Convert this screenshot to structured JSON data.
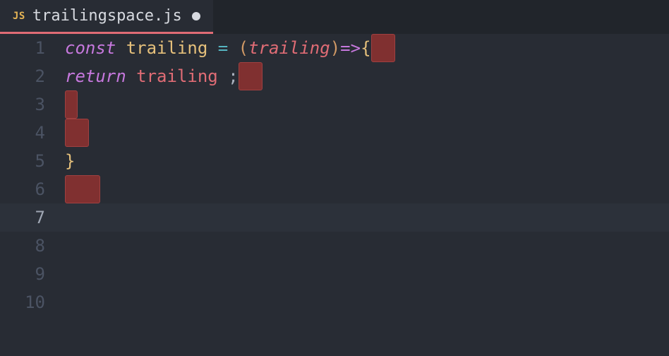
{
  "tab": {
    "lang_badge": "JS",
    "filename": "trailingspace.js",
    "dirty": true
  },
  "colors": {
    "background": "#282c34",
    "tab_underline": "#e06c75",
    "trailing_highlight": "#803030"
  },
  "editor": {
    "current_line": 7,
    "lines": [
      {
        "num": "1",
        "tokens": [
          {
            "t": "const ",
            "c": "tok-keyword"
          },
          {
            "t": "trailing ",
            "c": "tok-const"
          },
          {
            "t": "= ",
            "c": "tok-op"
          },
          {
            "t": "(",
            "c": "tok-paren"
          },
          {
            "t": "trailing",
            "c": "tok-param"
          },
          {
            "t": ")",
            "c": "tok-paren"
          },
          {
            "t": " ",
            "c": "tok-plain"
          },
          {
            "t": "=>",
            "c": "tok-arrow"
          },
          {
            "t": " ",
            "c": "tok-plain"
          },
          {
            "t": "{",
            "c": "tok-brace"
          }
        ],
        "trailing": 2
      },
      {
        "num": "2",
        "indent_bg": "  ",
        "tokens": [
          {
            "t": "return ",
            "c": "tok-return"
          },
          {
            "t": "trailing ",
            "c": "tok-ident"
          },
          {
            "t": ";",
            "c": "tok-punct"
          }
        ],
        "trailing": 2
      },
      {
        "num": "3",
        "tokens": [],
        "trailing": 1
      },
      {
        "num": "4",
        "tokens": [],
        "trailing": 2
      },
      {
        "num": "5",
        "tokens": [
          {
            "t": "}",
            "c": "tok-brace"
          }
        ],
        "trailing": 0
      },
      {
        "num": "6",
        "tokens": [],
        "trailing": 3
      },
      {
        "num": "7",
        "tokens": [],
        "trailing": 0
      },
      {
        "num": "8",
        "tokens": [],
        "trailing": 0
      },
      {
        "num": "9",
        "tokens": [],
        "trailing": 0
      },
      {
        "num": "10",
        "tokens": [],
        "trailing": 0
      }
    ]
  }
}
